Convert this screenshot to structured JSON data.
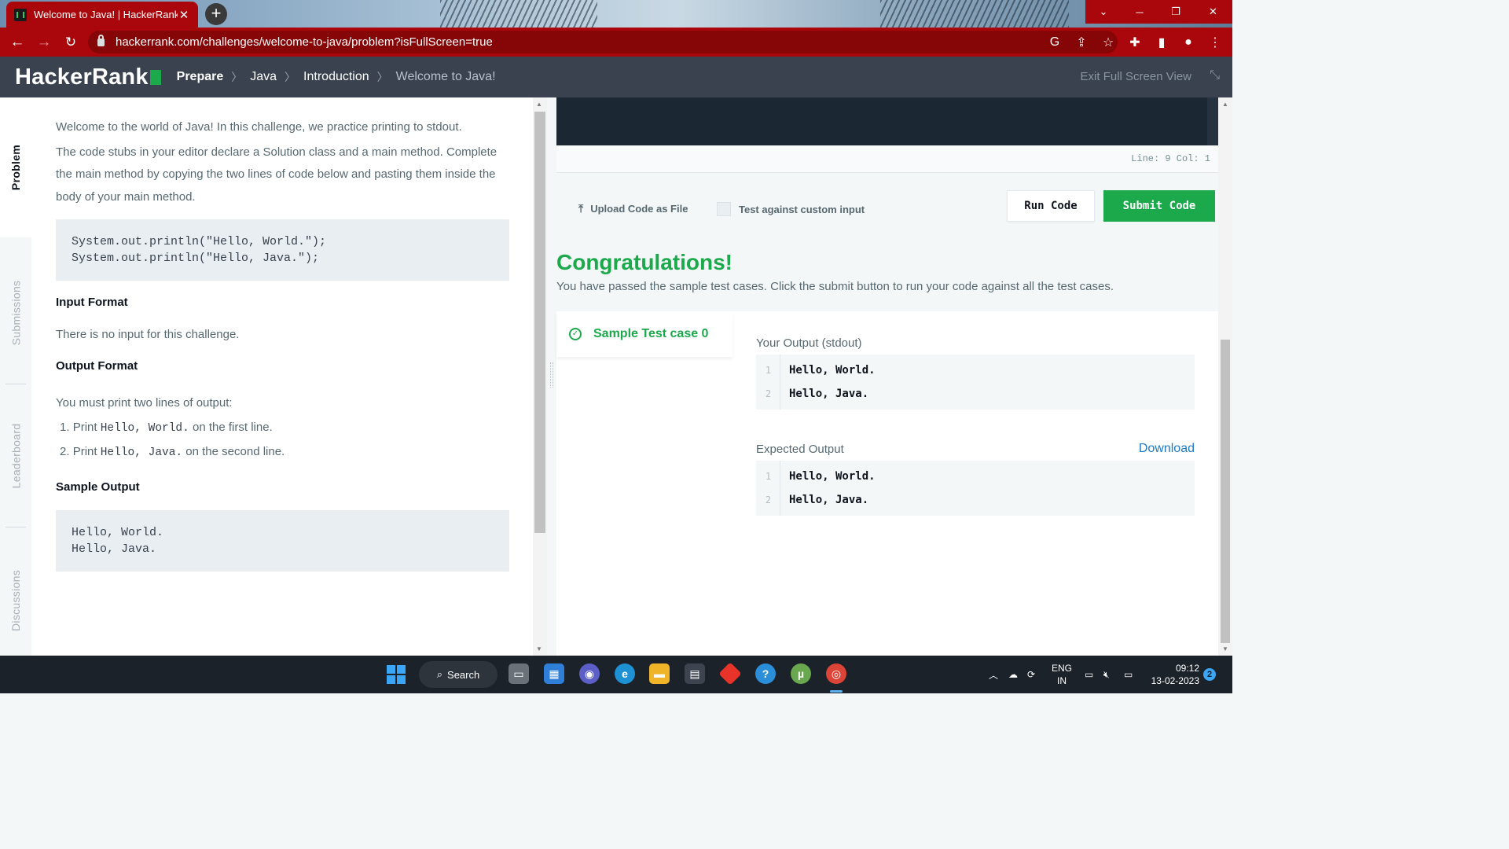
{
  "browser": {
    "tab_title": "Welcome to Java! | HackerRank",
    "url": "hackerrank.com/challenges/welcome-to-java/problem?isFullScreen=true"
  },
  "header": {
    "logo_text": "HackerRank",
    "breadcrumbs": [
      "Prepare",
      "Java",
      "Introduction",
      "Welcome to Java!"
    ],
    "exit_fullscreen": "Exit Full Screen View"
  },
  "side_tabs": [
    "Problem",
    "Submissions",
    "Leaderboard",
    "Discussions"
  ],
  "problem": {
    "intro": "Welcome to the world of Java! In this challenge, we practice printing to stdout.",
    "body": "The code stubs in your editor declare a Solution class and a main method. Complete the main method by copying the two lines of code below and pasting them inside the body of your main method.",
    "code_lines": [
      "System.out.println(\"Hello, World.\");",
      "System.out.println(\"Hello, Java.\");"
    ],
    "input_heading": "Input Format",
    "input_text": "There is no input for this challenge.",
    "output_heading": "Output Format",
    "output_text": "You must print two lines of output:",
    "list": [
      {
        "num": "1.",
        "pre": "Print ",
        "code": "Hello, World.",
        "post": " on the first line."
      },
      {
        "num": "2.",
        "pre": "Print ",
        "code": "Hello, Java.",
        "post": " on the second line."
      }
    ],
    "sample_heading": "Sample Output",
    "sample_lines": [
      "Hello, World.",
      "Hello, Java."
    ]
  },
  "editor": {
    "status": "Line: 9 Col: 1",
    "upload_label": "Upload Code as File",
    "custom_input_label": "Test against custom input",
    "run_label": "Run Code",
    "submit_label": "Submit Code"
  },
  "result": {
    "title": "Congratulations!",
    "message": "You have passed the sample test cases. Click the submit button to run your code against all the test cases.",
    "test_case": "Sample Test case 0",
    "your_output_label": "Your Output (stdout)",
    "expected_label": "Expected Output",
    "download_label": "Download",
    "your_output": [
      {
        "n": "1",
        "t": "Hello, World."
      },
      {
        "n": "2",
        "t": "Hello, Java."
      }
    ],
    "expected_output": [
      {
        "n": "1",
        "t": "Hello, World."
      },
      {
        "n": "2",
        "t": "Hello, Java."
      }
    ]
  },
  "taskbar": {
    "search_label": "Search",
    "lang_line1": "ENG",
    "lang_line2": "IN",
    "time": "09:12",
    "date": "13-02-2023",
    "notification_count": "2"
  },
  "colors": {
    "browser_red": "#a9070b",
    "hr_dark": "#39424e",
    "hr_green": "#1ba94c",
    "link_blue": "#1d7ac4"
  }
}
